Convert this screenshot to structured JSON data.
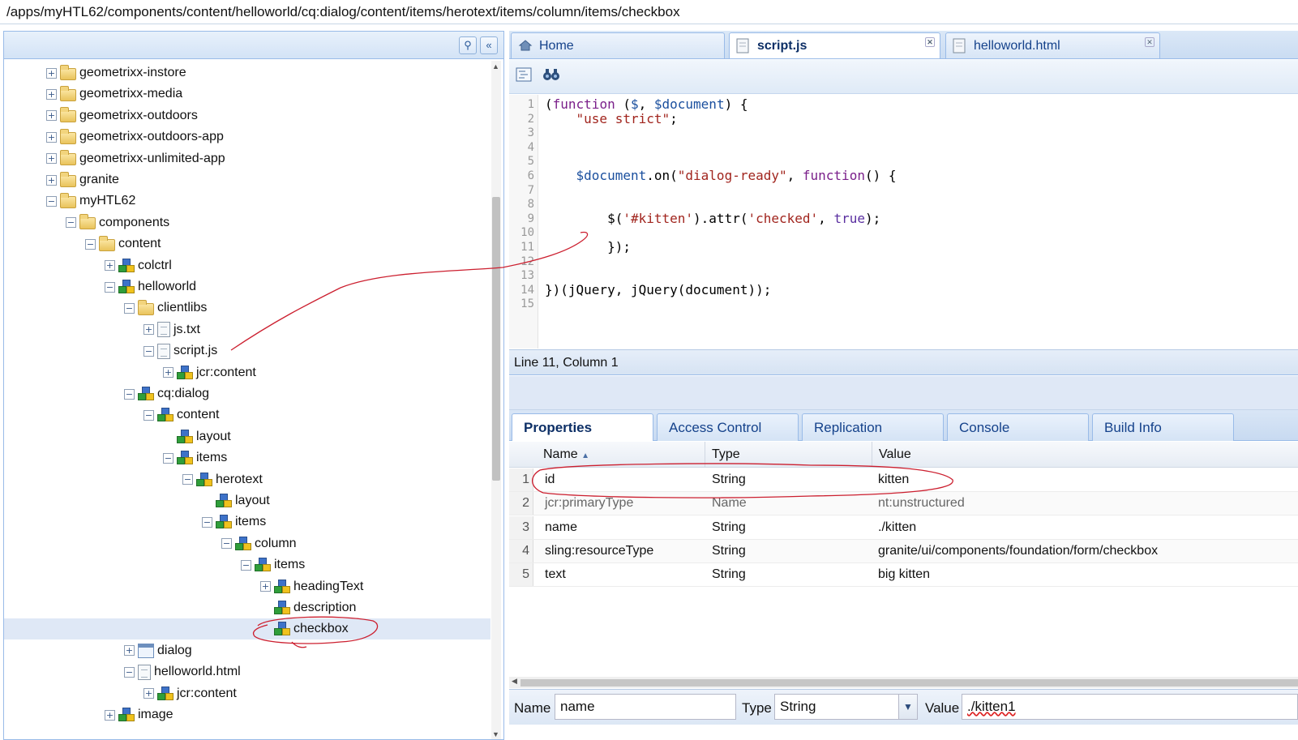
{
  "path": "/apps/myHTL62/components/content/helloworld/cq:dialog/content/items/herotext/items/column/items/checkbox",
  "tree": [
    {
      "label": "geometrixx-instore",
      "icon": "folder",
      "exp": "+"
    },
    {
      "label": "geometrixx-media",
      "icon": "folder",
      "exp": "+"
    },
    {
      "label": "geometrixx-outdoors",
      "icon": "folder",
      "exp": "+"
    },
    {
      "label": "geometrixx-outdoors-app",
      "icon": "folder",
      "exp": "+"
    },
    {
      "label": "geometrixx-unlimited-app",
      "icon": "folder",
      "exp": "+"
    },
    {
      "label": "granite",
      "icon": "folder",
      "exp": "+"
    },
    {
      "label": "myHTL62",
      "icon": "folder",
      "exp": "−"
    },
    {
      "label": "components",
      "icon": "folder",
      "exp": "−"
    },
    {
      "label": "content",
      "icon": "folder",
      "exp": "−"
    },
    {
      "label": "colctrl",
      "icon": "component",
      "exp": "+"
    },
    {
      "label": "helloworld",
      "icon": "component",
      "exp": "−"
    },
    {
      "label": "clientlibs",
      "icon": "folder",
      "exp": "−"
    },
    {
      "label": "js.txt",
      "icon": "file",
      "exp": "+"
    },
    {
      "label": "script.js",
      "icon": "file",
      "exp": "−"
    },
    {
      "label": "jcr:content",
      "icon": "component",
      "exp": "+"
    },
    {
      "label": "cq:dialog",
      "icon": "component",
      "exp": "−"
    },
    {
      "label": "content",
      "icon": "component",
      "exp": "−"
    },
    {
      "label": "layout",
      "icon": "component",
      "exp": ""
    },
    {
      "label": "items",
      "icon": "component",
      "exp": "−"
    },
    {
      "label": "herotext",
      "icon": "component",
      "exp": "−"
    },
    {
      "label": "layout",
      "icon": "component",
      "exp": ""
    },
    {
      "label": "items",
      "icon": "component",
      "exp": "−"
    },
    {
      "label": "column",
      "icon": "component",
      "exp": "−"
    },
    {
      "label": "items",
      "icon": "component",
      "exp": "−"
    },
    {
      "label": "headingText",
      "icon": "component",
      "exp": "+"
    },
    {
      "label": "description",
      "icon": "component",
      "exp": ""
    },
    {
      "label": "checkbox",
      "icon": "component",
      "exp": "",
      "selected": true
    },
    {
      "label": "dialog",
      "icon": "dialog",
      "exp": "+"
    },
    {
      "label": "helloworld.html",
      "icon": "file",
      "exp": "−"
    },
    {
      "label": "jcr:content",
      "icon": "component",
      "exp": "+"
    },
    {
      "label": "image",
      "icon": "component",
      "exp": "+"
    }
  ],
  "editor_tabs": [
    {
      "label": "Home",
      "icon": "home-icon",
      "closable": false
    },
    {
      "label": "script.js",
      "icon": "file-icon",
      "closable": true,
      "active": true
    },
    {
      "label": "helloworld.html",
      "icon": "file-icon",
      "closable": true
    }
  ],
  "code_lines": [
    "(function ($, $document) {",
    "    \"use strict\";",
    "",
    "",
    "",
    "    $document.on(\"dialog-ready\", function() {",
    "",
    "",
    "        $('#kitten').attr('checked', true);",
    "",
    "        });",
    "",
    "",
    "})(jQuery, jQuery(document));",
    ""
  ],
  "line_numbers": [
    "1",
    "2",
    "3",
    "4",
    "5",
    "6",
    "7",
    "8",
    "9",
    "10",
    "11",
    "12",
    "13",
    "14",
    "15"
  ],
  "status": "Line 11, Column 1",
  "prop_tabs": [
    "Properties",
    "Access Control",
    "Replication",
    "Console",
    "Build Info"
  ],
  "grid_headers": {
    "name": "Name",
    "type": "Type",
    "value": "Value"
  },
  "grid_rows": [
    {
      "num": "1",
      "name": "id",
      "type": "String",
      "value": "kitten"
    },
    {
      "num": "2",
      "name": "jcr:primaryType",
      "type": "Name",
      "value": "nt:unstructured"
    },
    {
      "num": "3",
      "name": "name",
      "type": "String",
      "value": "./kitten"
    },
    {
      "num": "4",
      "name": "sling:resourceType",
      "type": "String",
      "value": "granite/ui/components/foundation/form/checkbox"
    },
    {
      "num": "5",
      "name": "text",
      "type": "String",
      "value": "big kitten"
    }
  ],
  "edit_bar": {
    "name_label": "Name",
    "name_value": "name",
    "type_label": "Type",
    "type_value": "String",
    "value_label": "Value",
    "value_value": "./kitten1"
  },
  "annotation_color": "#cc1f2f"
}
